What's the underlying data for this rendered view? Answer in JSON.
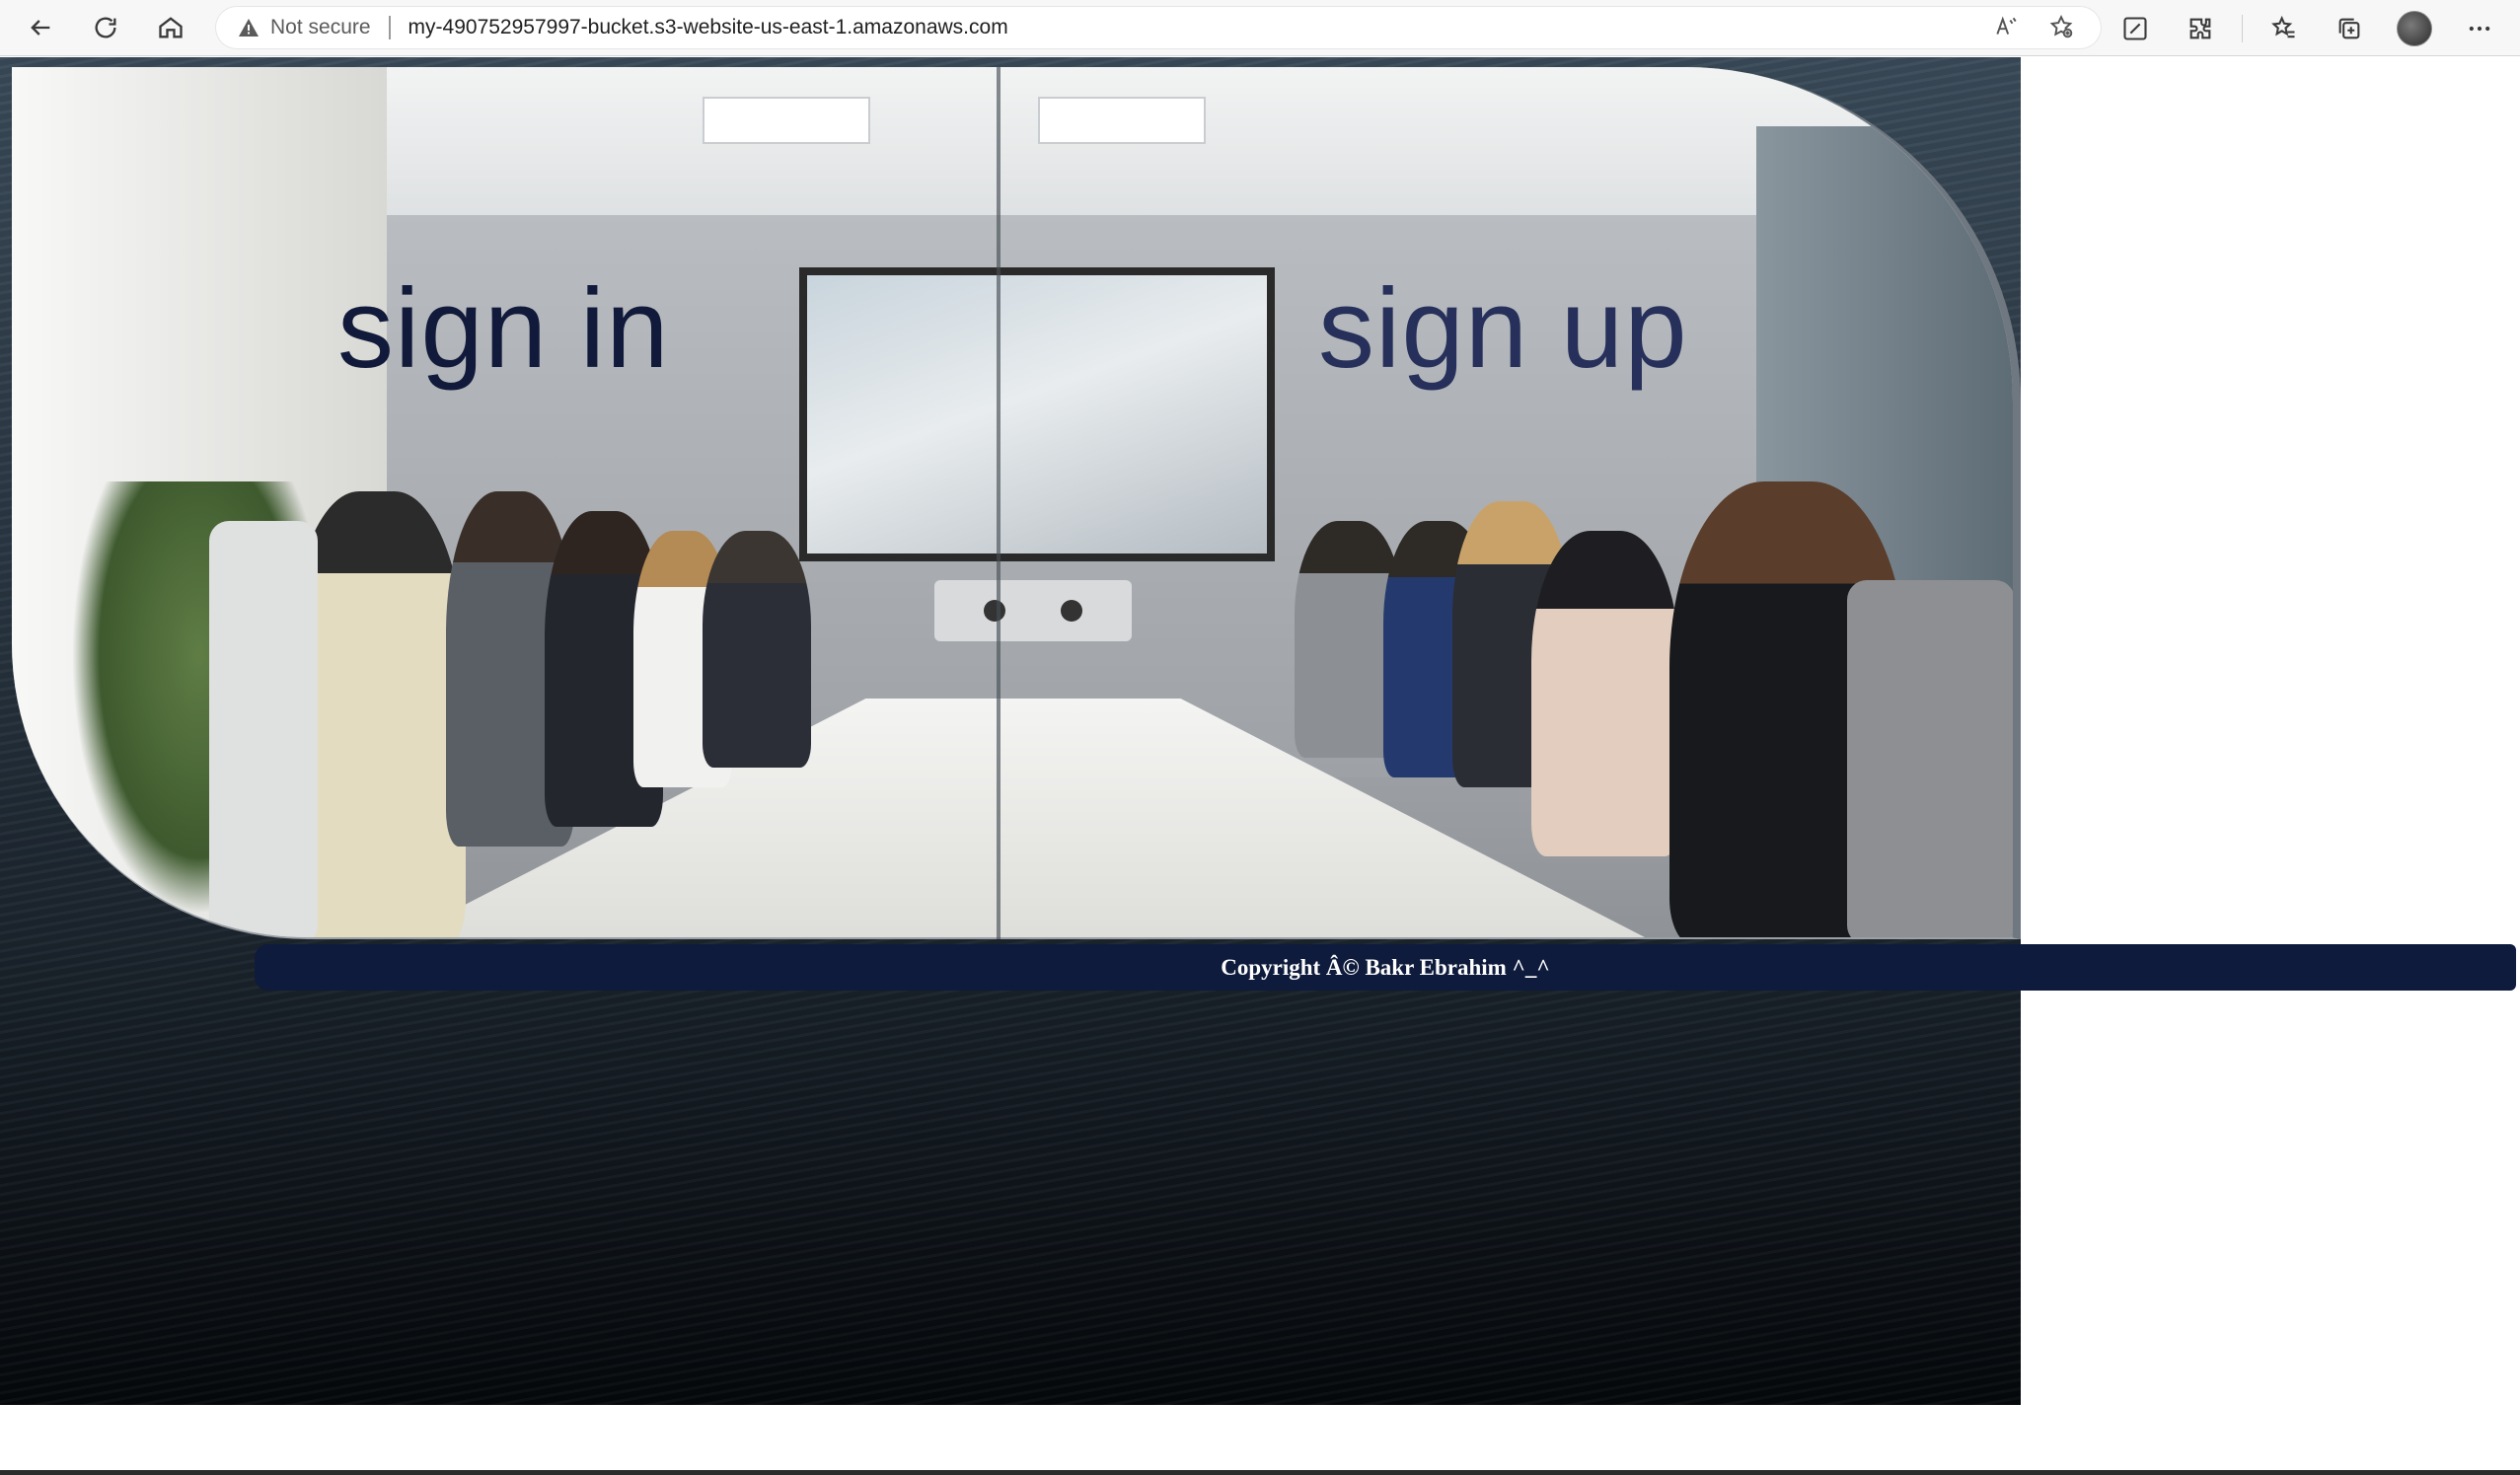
{
  "browser": {
    "security_label": "Not secure",
    "url": "my-490752957997-bucket.s3-website-us-east-1.amazonaws.com",
    "icons": [
      "back-icon",
      "refresh-icon",
      "home-icon",
      "warning-icon",
      "read-aloud-icon",
      "add-favorite-icon",
      "screenshot-icon",
      "extensions-icon",
      "favorites-icon",
      "collections-icon",
      "profile-avatar",
      "more-icon"
    ]
  },
  "main": {
    "signin_label": "sign in",
    "signup_label": "sign up"
  },
  "footer": {
    "copyright": "Copyright Â© Bakr Ebrahim ^_^"
  },
  "colors": {
    "footer_bg": "#0f1b3c",
    "signin_text": "#111a3a",
    "signup_text": "#26305a"
  }
}
